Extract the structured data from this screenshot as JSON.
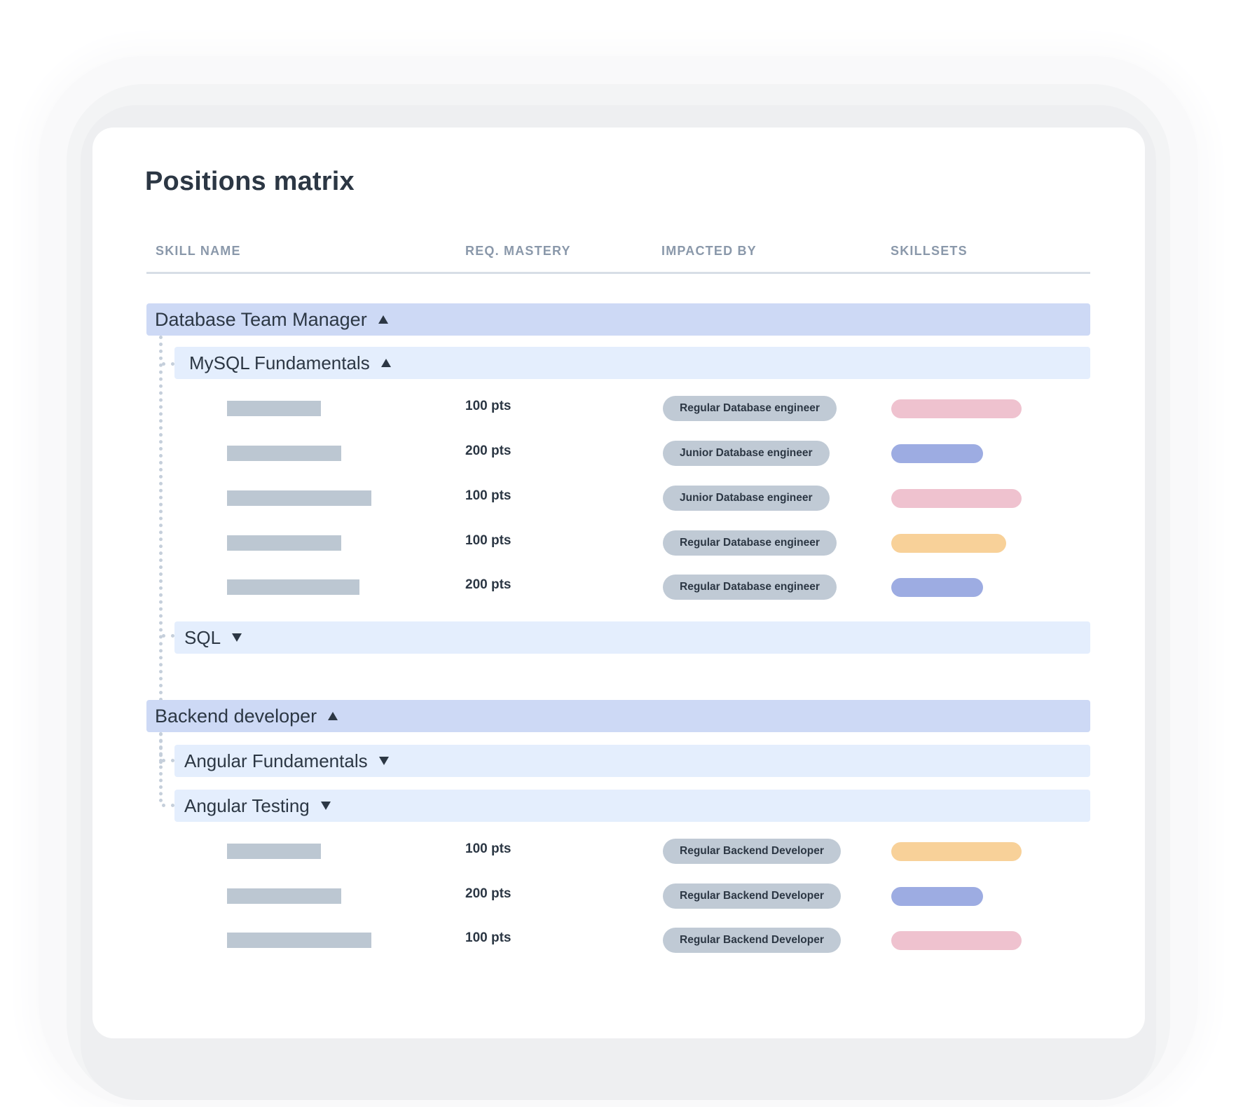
{
  "title": "Positions matrix",
  "columns": {
    "skill_name": "SKILL NAME",
    "req_mastery": "REQ. MASTERY",
    "impacted_by": "IMPACTED BY",
    "skillsets": "SKILLSETS"
  },
  "colors": {
    "pink": "#efc2cf",
    "blue": "#9dace2",
    "orange": "#f8d199",
    "group_bg": "#cdd9f5",
    "sub_bg": "#e4eefd",
    "pill_bg": "#c0cad5"
  },
  "groups": [
    {
      "label": "Database Team Manager",
      "state": "expanded",
      "subgroups": [
        {
          "label": "MySQL Fundamentals",
          "state": "expanded",
          "rows": [
            {
              "points": "100 pts",
              "impacted_by": "Regular Database engineer",
              "skillset_color": "pink"
            },
            {
              "points": "200 pts",
              "impacted_by": "Junior Database engineer",
              "skillset_color": "blue"
            },
            {
              "points": "100 pts",
              "impacted_by": "Junior Database engineer",
              "skillset_color": "pink"
            },
            {
              "points": "100 pts",
              "impacted_by": "Regular Database engineer",
              "skillset_color": "orange"
            },
            {
              "points": "200 pts",
              "impacted_by": "Regular Database engineer",
              "skillset_color": "blue"
            }
          ]
        },
        {
          "label": "SQL",
          "state": "collapsed",
          "rows": []
        }
      ]
    },
    {
      "label": "Backend developer",
      "state": "expanded",
      "subgroups": [
        {
          "label": "Angular Fundamentals",
          "state": "collapsed",
          "rows": []
        },
        {
          "label": "Angular Testing",
          "state": "collapsed",
          "rows": [
            {
              "points": "100 pts",
              "impacted_by": "Regular Backend Developer",
              "skillset_color": "orange"
            },
            {
              "points": "200 pts",
              "impacted_by": "Regular Backend Developer",
              "skillset_color": "blue"
            },
            {
              "points": "100 pts",
              "impacted_by": "Regular Backend Developer",
              "skillset_color": "pink"
            }
          ]
        }
      ]
    }
  ]
}
